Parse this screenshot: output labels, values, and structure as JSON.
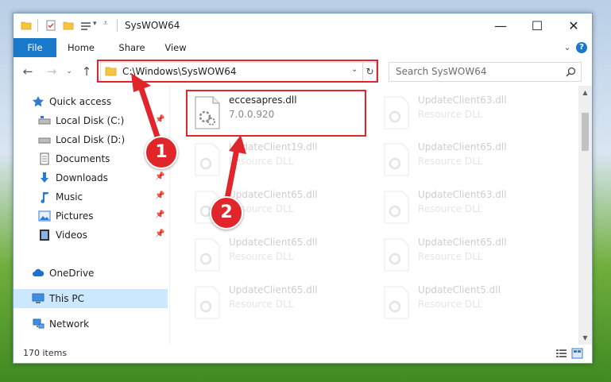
{
  "window": {
    "title": "SysWOW64",
    "controls": {
      "minimize": "—",
      "maximize": "☐",
      "close": "✕"
    }
  },
  "ribbon": {
    "tabs": [
      "File",
      "Home",
      "Share",
      "View"
    ],
    "help": "?",
    "expand": "⌄"
  },
  "navigation": {
    "back": "←",
    "forward": "→",
    "recent": "⌄",
    "up": "↑"
  },
  "address": {
    "path": "C:\\Windows\\SysWOW64",
    "dropdown": "⌄",
    "refresh": "↻"
  },
  "search": {
    "placeholder": "Search SysWOW64",
    "icon": "search-icon"
  },
  "sidebar": {
    "items": [
      {
        "label": "Quick access",
        "icon": "star-icon",
        "pinned": false
      },
      {
        "label": "Local Disk (C:)",
        "icon": "drive-icon",
        "pinned": true
      },
      {
        "label": "Local Disk (D:)",
        "icon": "drive-icon",
        "pinned": false
      },
      {
        "label": "Documents",
        "icon": "documents-icon",
        "pinned": true
      },
      {
        "label": "Downloads",
        "icon": "download-icon",
        "pinned": true
      },
      {
        "label": "Music",
        "icon": "music-icon",
        "pinned": true
      },
      {
        "label": "Pictures",
        "icon": "pictures-icon",
        "pinned": true
      },
      {
        "label": "Videos",
        "icon": "videos-icon",
        "pinned": true
      },
      {
        "label": "OneDrive",
        "icon": "cloud-icon",
        "pinned": false
      },
      {
        "label": "This PC",
        "icon": "computer-icon",
        "pinned": false,
        "selected": true
      },
      {
        "label": "Network",
        "icon": "network-icon",
        "pinned": false
      }
    ],
    "pin_glyph": "📌"
  },
  "files": {
    "left": [
      {
        "name": "eccesapres.dll",
        "sub": "7.0.0.920"
      },
      {
        "name": "UpdateClient19.dll",
        "sub": "Resource DLL"
      },
      {
        "name": "UpdateClient65.dll",
        "sub": "Resource DLL"
      },
      {
        "name": "UpdateClient65.dll",
        "sub": "Resource DLL"
      },
      {
        "name": "UpdateClient65.dll",
        "sub": "Resource DLL"
      }
    ],
    "right": [
      {
        "name": "UpdateClient63.dll",
        "sub": "Resource DLL"
      },
      {
        "name": "UpdateClient65.dll",
        "sub": "Resource DLL"
      },
      {
        "name": "UpdateClient63.dll",
        "sub": "Resource DLL"
      },
      {
        "name": "UpdateClient65.dll",
        "sub": "Resource DLL"
      },
      {
        "name": "UpdateClient5.dll",
        "sub": "Resource DLL"
      }
    ]
  },
  "status": {
    "items_count": "170 items"
  },
  "annotations": {
    "badge_1": "1",
    "badge_2": "2",
    "color": "#e0262b"
  },
  "colors": {
    "accent": "#1979ca",
    "selection": "#cce8ff",
    "annotation": "#e0262b"
  }
}
